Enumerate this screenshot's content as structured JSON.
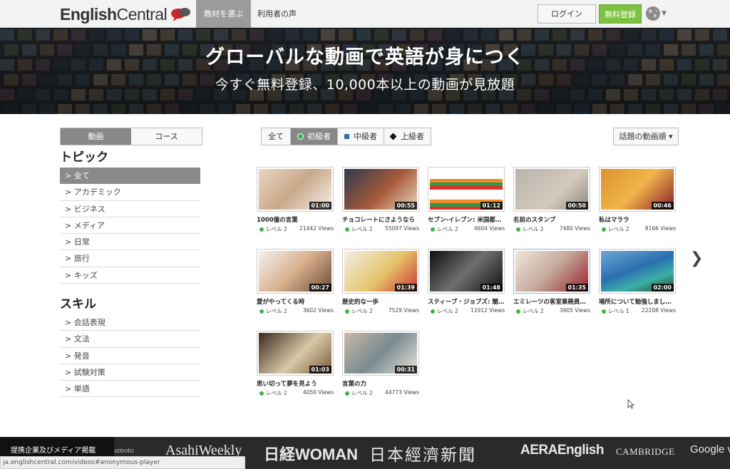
{
  "header": {
    "logo_prefix": "English",
    "logo_suffix": "Central",
    "nav": [
      "教材を選ぶ",
      "利用者の声"
    ],
    "login": "ログイン",
    "register": "無料登録"
  },
  "hero": {
    "title": "グローバルな動画で英語が身につく",
    "subtitle": "今すぐ無料登録、10,000本以上の動画が見放題"
  },
  "sidebar": {
    "tabs": [
      "動画",
      "コース"
    ],
    "topic_title": "トピック",
    "topics": [
      "> 全て",
      "> アカデミック",
      "> ビジネス",
      "> メディア",
      "> 日常",
      "> 旅行",
      "> キッズ"
    ],
    "skill_title": "スキル",
    "skills": [
      "> 会話表現",
      "> 文法",
      "> 発音",
      "> 試験対策",
      "> 単語"
    ]
  },
  "filters": {
    "all": "全て",
    "beginner": "初級者",
    "intermediate": "中級者",
    "advanced": "上級者",
    "sort": "話題の動画順 ▾"
  },
  "videos": [
    {
      "title": "1000億の言葉",
      "level": "レベル 2",
      "views": "21442 Views",
      "duration": "01:00"
    },
    {
      "title": "チョコレートにさようなら",
      "level": "レベル 2",
      "views": "55097 Views",
      "duration": "00:55"
    },
    {
      "title": "セブン-イレブン: 米国都市…",
      "level": "レベル 2",
      "views": "4604 Views",
      "duration": "01:12"
    },
    {
      "title": "名前のスタンプ",
      "level": "レベル 2",
      "views": "7480 Views",
      "duration": "00:50"
    },
    {
      "title": "私はマララ",
      "level": "レベル 2",
      "views": "8166 Views",
      "duration": "00:46"
    },
    {
      "title": "愛がやってくる時",
      "level": "レベル 2",
      "views": "3602 Views",
      "duration": "00:27"
    },
    {
      "title": "歴史的な一歩",
      "level": "レベル 2",
      "views": "7529 Views",
      "duration": "01:39"
    },
    {
      "title": "スティーブ・ジョブズ: 闇…",
      "level": "レベル 2",
      "views": "11912 Views",
      "duration": "01:48"
    },
    {
      "title": "エミレーツの客室乗務員に…",
      "level": "レベル 2",
      "views": "3905 Views",
      "duration": "01:35"
    },
    {
      "title": "場所について勉強しましょ…",
      "level": "レベル 1",
      "views": "22208 Views",
      "duration": "02:00"
    },
    {
      "title": "思い切って夢を見よう",
      "level": "レベル 2",
      "views": "4050 Views",
      "duration": "01:03"
    },
    {
      "title": "言葉の力",
      "level": "レベル 2",
      "views": "44773 Views",
      "duration": "00:31"
    }
  ],
  "partners": {
    "label": "提携企業及びメディア掲載",
    "logos": [
      "Yamamoto",
      "AsahiWeekly",
      "日経WOMAN",
      "日本經濟新聞",
      "AERAEnglish",
      "CAMBRIDGE",
      "Google ventures"
    ]
  },
  "status_url": "ja.englishcentral.com/videos#anonymous-player",
  "colors": {
    "accent_green": "#7dc142",
    "level_dot": "#3bb54a",
    "intermediate": "#2b6db0"
  }
}
